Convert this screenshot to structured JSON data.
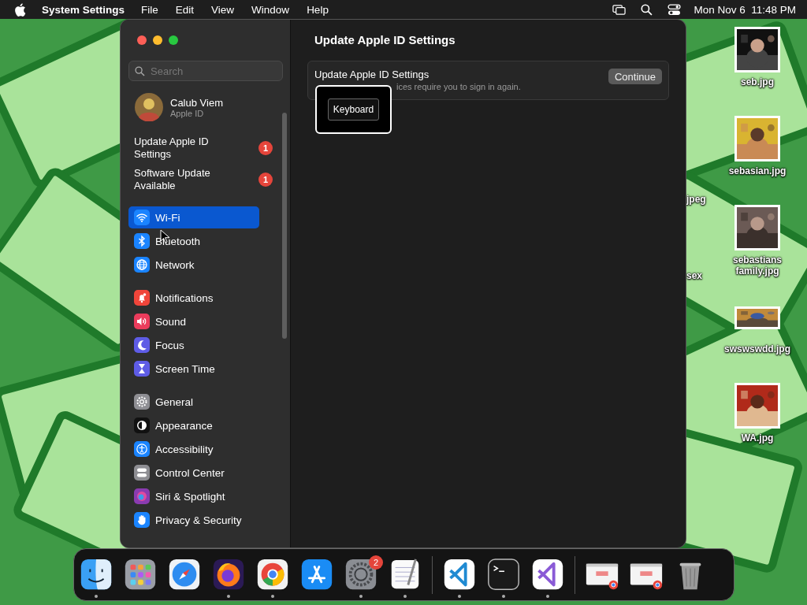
{
  "menu_bar": {
    "app_name": "System Settings",
    "menus": [
      "File",
      "Edit",
      "View",
      "Window",
      "Help"
    ],
    "clock": "Mon Nov 6  11:48 PM"
  },
  "window": {
    "title": "Update Apple ID Settings",
    "sidebar": {
      "search": {
        "placeholder": "Search"
      },
      "account": {
        "name": "Calub Viem",
        "subtitle": "Apple ID"
      },
      "notices": [
        {
          "label": "Update Apple ID Settings",
          "badge": "1"
        },
        {
          "label": "Software Update Available",
          "badge": "1"
        }
      ],
      "groups": [
        {
          "items": [
            {
              "label": "Wi-Fi",
              "kind": "wifi",
              "color": "#1a84ff",
              "selected": true
            },
            {
              "label": "Bluetooth",
              "kind": "bluetooth",
              "color": "#1a84ff",
              "selected": false
            },
            {
              "label": "Network",
              "kind": "globe",
              "color": "#1a84ff",
              "selected": false
            }
          ]
        },
        {
          "items": [
            {
              "label": "Notifications",
              "kind": "bell",
              "color": "#f0453a",
              "selected": false
            },
            {
              "label": "Sound",
              "kind": "speaker",
              "color": "#eb3c5c",
              "selected": false
            },
            {
              "label": "Focus",
              "kind": "moon",
              "color": "#5e5ce6",
              "selected": false
            },
            {
              "label": "Screen Time",
              "kind": "hourglass",
              "color": "#5e5ce6",
              "selected": false
            }
          ]
        },
        {
          "items": [
            {
              "label": "General",
              "kind": "gear",
              "color": "#8e8e93",
              "selected": false
            },
            {
              "label": "Appearance",
              "kind": "contrast",
              "color": "#111111",
              "selected": false
            },
            {
              "label": "Accessibility",
              "kind": "person",
              "color": "#1a84ff",
              "selected": false
            },
            {
              "label": "Control Center",
              "kind": "toggles",
              "color": "#8e8e93",
              "selected": false
            },
            {
              "label": "Siri & Spotlight",
              "kind": "orb",
              "color": "#8a3bb0",
              "selected": false
            },
            {
              "label": "Privacy & Security",
              "kind": "hand",
              "color": "#1a84ff",
              "selected": false
            }
          ]
        }
      ]
    },
    "card": {
      "title": "Update Apple ID Settings",
      "subtitle": "ices require you to sign in again.",
      "button": "Continue"
    },
    "overlay": {
      "key": "Keyboard"
    }
  },
  "desktop": {
    "cut_labels": [
      "jpeg",
      "sex"
    ],
    "files": [
      {
        "name": "seb.jpg",
        "kind": "picture"
      },
      {
        "name": "sebasian.jpg",
        "kind": "picture"
      },
      {
        "name": "sebastians family.jpg",
        "kind": "picture"
      },
      {
        "name": "swswswdd.jpg",
        "kind": "picture"
      },
      {
        "name": "WA.jpg",
        "kind": "picture"
      }
    ]
  },
  "dock": {
    "sections": [
      {
        "items": [
          {
            "kind": "finder",
            "running": true
          },
          {
            "kind": "launchpad",
            "running": false
          },
          {
            "kind": "safari",
            "running": false
          },
          {
            "kind": "firefox",
            "running": true
          },
          {
            "kind": "chrome",
            "running": true
          },
          {
            "kind": "appstore",
            "running": false
          },
          {
            "kind": "settings",
            "running": true,
            "badge": "2"
          },
          {
            "kind": "textedit",
            "running": true
          }
        ]
      },
      {
        "items": [
          {
            "kind": "vscode",
            "running": true
          },
          {
            "kind": "terminal",
            "running": true
          },
          {
            "kind": "visualstudio",
            "running": true
          }
        ]
      },
      {
        "items": [
          {
            "kind": "window",
            "running": false
          },
          {
            "kind": "window",
            "running": false
          },
          {
            "kind": "trash",
            "running": false
          }
        ]
      }
    ]
  }
}
